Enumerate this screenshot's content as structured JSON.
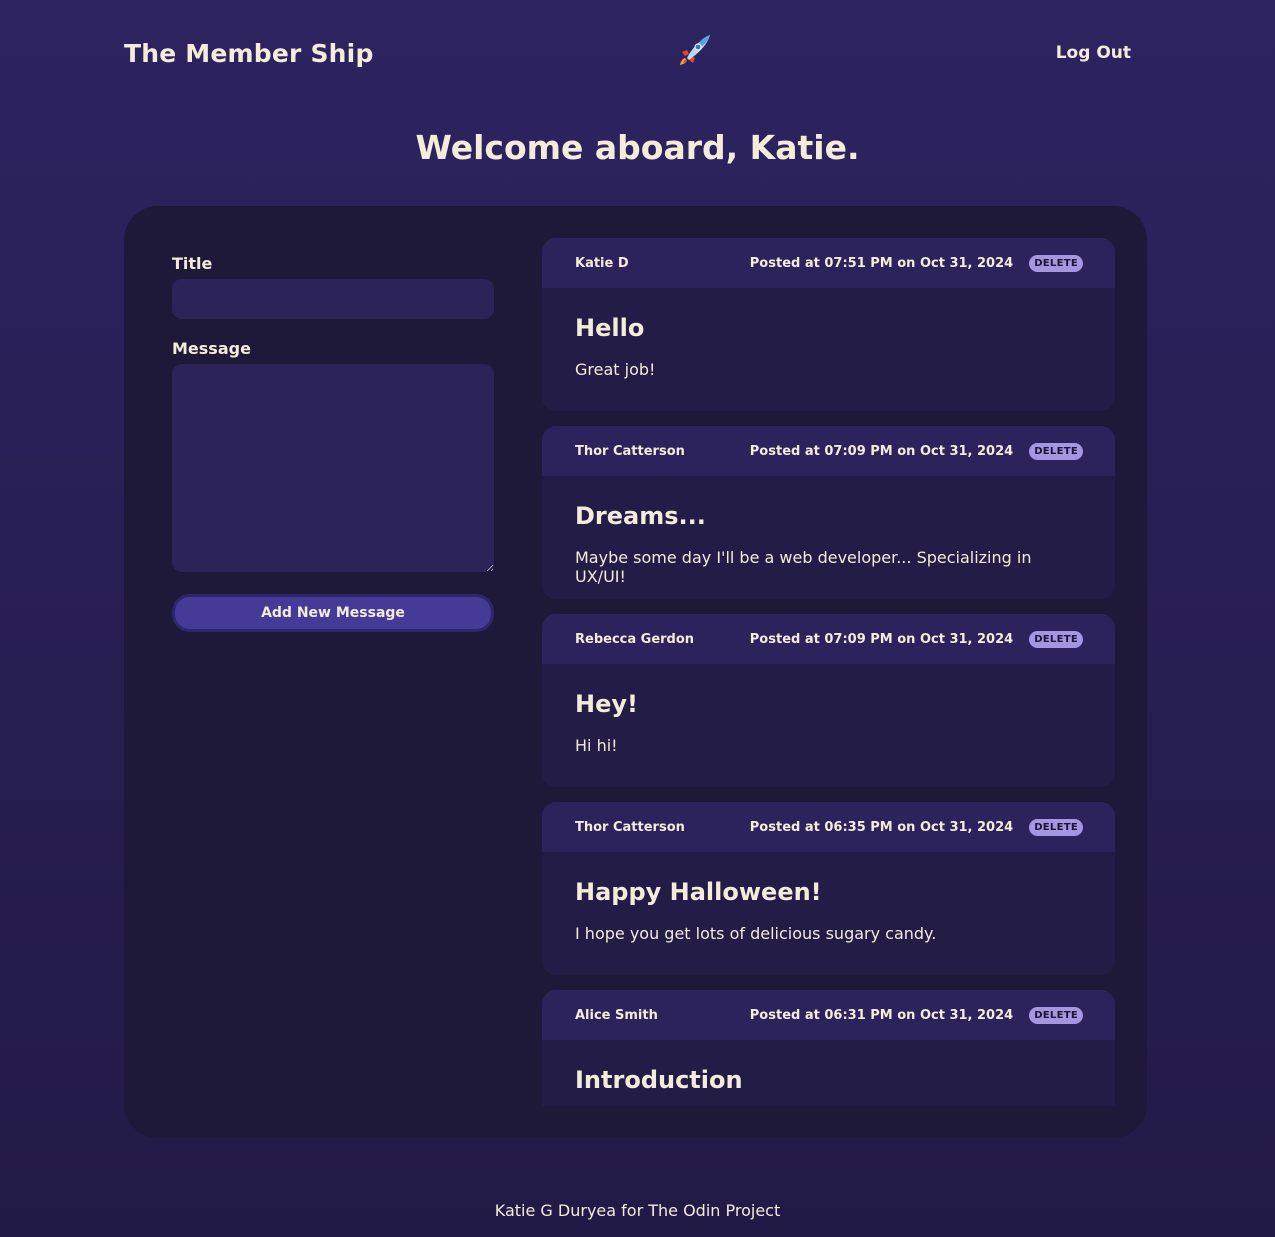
{
  "header": {
    "brand": "The Member Ship",
    "logo_icon": "rocket-icon",
    "logout_label": "Log Out"
  },
  "welcome": "Welcome aboard, Katie.",
  "form": {
    "title_label": "Title",
    "title_value": "",
    "message_label": "Message",
    "message_value": "",
    "submit_label": "Add New Message"
  },
  "messages": [
    {
      "author": "Katie D",
      "posted": "Posted at 07:51 PM on Oct 31, 2024",
      "delete_label": "DELETE",
      "title": "Hello",
      "text": "Great job!"
    },
    {
      "author": "Thor Catterson",
      "posted": "Posted at 07:09 PM on Oct 31, 2024",
      "delete_label": "DELETE",
      "title": "Dreams...",
      "text": "Maybe some day I'll be a web developer... Specializing in UX/UI!"
    },
    {
      "author": "Rebecca Gerdon",
      "posted": "Posted at 07:09 PM on Oct 31, 2024",
      "delete_label": "DELETE",
      "title": "Hey!",
      "text": "Hi hi!"
    },
    {
      "author": "Thor Catterson",
      "posted": "Posted at 06:35 PM on Oct 31, 2024",
      "delete_label": "DELETE",
      "title": "Happy Halloween!",
      "text": "I hope you get lots of delicious sugary candy."
    },
    {
      "author": "Alice Smith",
      "posted": "Posted at 06:31 PM on Oct 31, 2024",
      "delete_label": "DELETE",
      "title": "Introduction",
      "text": ""
    }
  ],
  "footer": "Katie G Duryea for The Odin Project",
  "colors": {
    "background": "#2d2360",
    "panel": "#1e1839",
    "card": "#231c47",
    "card_header": "#2c235c",
    "button": "#463a98",
    "delete_badge": "#a596e0",
    "text": "#f3ecd9"
  }
}
